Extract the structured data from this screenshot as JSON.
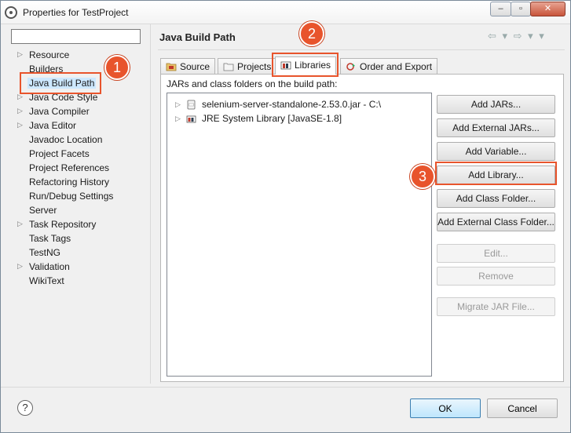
{
  "window": {
    "title": "Properties for TestProject",
    "minimize_glyph": "‒",
    "maximize_glyph": "▫",
    "close_glyph": "✕"
  },
  "filter": {
    "value": ""
  },
  "nav_items": [
    {
      "label": "Resource",
      "expandable": true
    },
    {
      "label": "Builders",
      "expandable": false
    },
    {
      "label": "Java Build Path",
      "expandable": false,
      "selected": true
    },
    {
      "label": "Java Code Style",
      "expandable": true
    },
    {
      "label": "Java Compiler",
      "expandable": true
    },
    {
      "label": "Java Editor",
      "expandable": true
    },
    {
      "label": "Javadoc Location",
      "expandable": false
    },
    {
      "label": "Project Facets",
      "expandable": false
    },
    {
      "label": "Project References",
      "expandable": false
    },
    {
      "label": "Refactoring History",
      "expandable": false
    },
    {
      "label": "Run/Debug Settings",
      "expandable": false
    },
    {
      "label": "Server",
      "expandable": false
    },
    {
      "label": "Task Repository",
      "expandable": true
    },
    {
      "label": "Task Tags",
      "expandable": false
    },
    {
      "label": "TestNG",
      "expandable": false
    },
    {
      "label": "Validation",
      "expandable": true
    },
    {
      "label": "WikiText",
      "expandable": false
    }
  ],
  "page": {
    "title": "Java Build Path",
    "nav_arrows": "⇦ ▾ ⇨ ▾ ▾"
  },
  "tabs": [
    {
      "label": "Source",
      "icon": "source-folder-icon"
    },
    {
      "label": "Projects",
      "icon": "projects-folder-icon"
    },
    {
      "label": "Libraries",
      "icon": "libraries-icon",
      "active": true
    },
    {
      "label": "Order and Export",
      "icon": "order-export-icon"
    }
  ],
  "libraries": {
    "caption": "JARs and class folders on the build path:",
    "entries": [
      {
        "label": "selenium-server-standalone-2.53.0.jar - C:\\",
        "icon": "jar-file-icon"
      },
      {
        "label": "JRE System Library [JavaSE-1.8]",
        "icon": "library-icon"
      }
    ]
  },
  "buttons": [
    {
      "label": "Add JARs...",
      "enabled": true
    },
    {
      "label": "Add External JARs...",
      "enabled": true
    },
    {
      "label": "Add Variable...",
      "enabled": true
    },
    {
      "label": "Add Library...",
      "enabled": true
    },
    {
      "label": "Add Class Folder...",
      "enabled": true
    },
    {
      "label": "Add External Class Folder...",
      "enabled": true
    },
    {
      "label": "Edit...",
      "enabled": false
    },
    {
      "label": "Remove",
      "enabled": false
    },
    {
      "label": "Migrate JAR File...",
      "enabled": false
    }
  ],
  "footer": {
    "help_glyph": "?",
    "ok_label": "OK",
    "cancel_label": "Cancel"
  },
  "annotations": [
    "1",
    "2",
    "3"
  ],
  "colors": {
    "callout": "#e8542c",
    "selection": "#cde8ff"
  }
}
